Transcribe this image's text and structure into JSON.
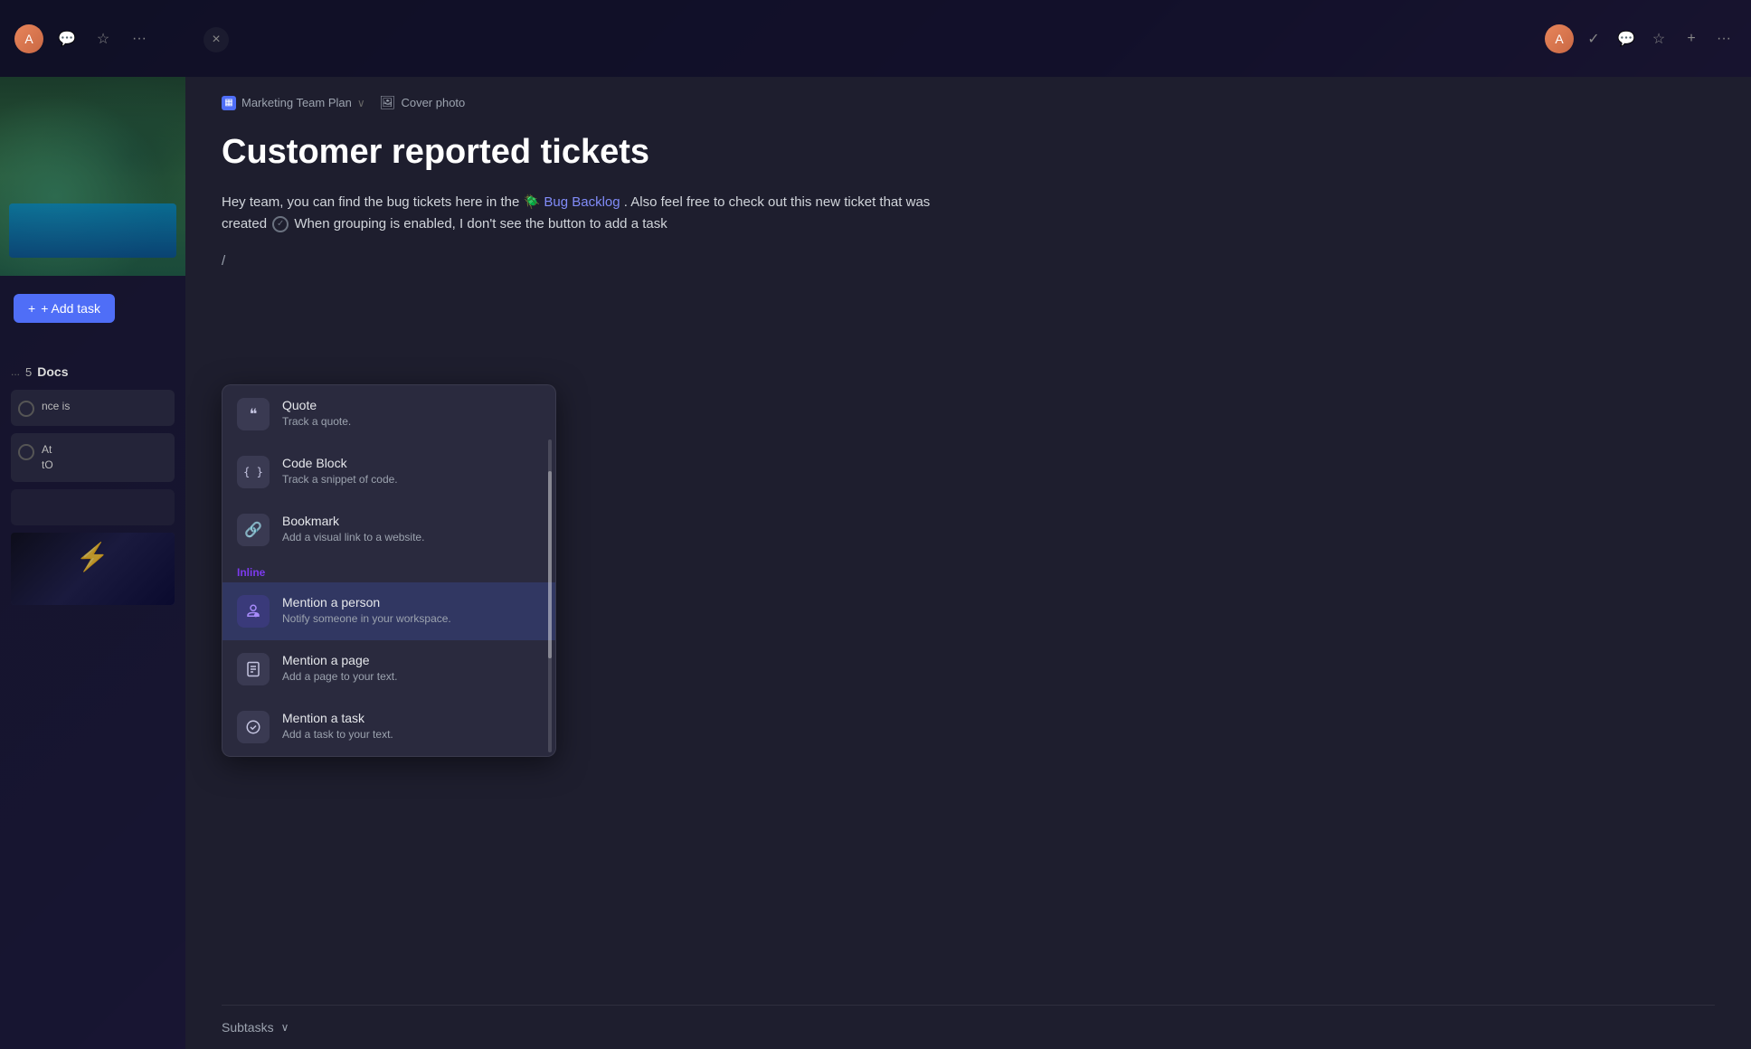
{
  "browser": {
    "avatar_text": "A",
    "close_label": "×",
    "icons": {
      "message": "💬",
      "star": "☆",
      "more": "···",
      "check": "✓",
      "plus": "+",
      "more_right": "···"
    }
  },
  "breadcrumb": {
    "project_name": "Marketing Team Plan",
    "chevron": "∨",
    "cover_photo_label": "Cover photo"
  },
  "page": {
    "title": "Customer reported tickets",
    "description_prefix": "Hey team, you can find the bug tickets here in the",
    "link_text": "🪲 Bug Backlog",
    "description_suffix": ". Also feel free to check out this new ticket that was created",
    "task_ref": "When grouping is enabled, I don't see the button to add a task",
    "slash": "/",
    "subtasks_label": "Subtasks",
    "subtasks_chevron": "∨"
  },
  "sidebar": {
    "add_task_label": "+ Add task",
    "badge_dots": "...",
    "badge_num": "5",
    "docs_label": "Docs",
    "task_items": [
      {
        "text_prefix": "nce is",
        "checkbox": false
      },
      {
        "text_prefix": "At",
        "text_line2": "to",
        "checkbox": false
      }
    ]
  },
  "dropdown": {
    "items": [
      {
        "id": "quote",
        "title": "Quote",
        "description": "Track a quote.",
        "icon": "❝"
      },
      {
        "id": "code-block",
        "title": "Code Block",
        "description": "Track a snippet of code.",
        "icon": "{ }"
      },
      {
        "id": "bookmark",
        "title": "Bookmark",
        "description": "Add a visual link to a website.",
        "icon": "🔗"
      }
    ],
    "section_label": "Inline",
    "inline_items": [
      {
        "id": "mention-person",
        "title": "Mention a person",
        "description": "Notify someone in your workspace.",
        "icon": "@",
        "active": true
      },
      {
        "id": "mention-page",
        "title": "Mention a page",
        "description": "Add a page to your text.",
        "icon": "📄"
      },
      {
        "id": "mention-task",
        "title": "Mention a task",
        "description": "Add a task to your text.",
        "icon": "✓"
      }
    ]
  }
}
